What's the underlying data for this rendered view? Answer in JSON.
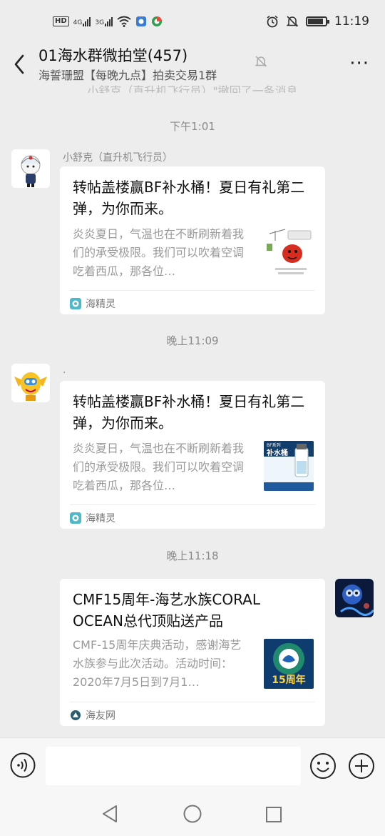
{
  "statusbar": {
    "hd": "HD",
    "net1": "4G",
    "net2": "3G",
    "time": "11:19"
  },
  "header": {
    "title": "01海水群微拍堂(457)",
    "subtitle": "海誓珊盟【每晚九点】拍卖交易1群",
    "more": "···"
  },
  "recall_notice": "小舒克（直升机飞行员）\"撤回了一条消息",
  "messages": [
    {
      "time": "下午1:01",
      "sender": "小舒克（直升机飞行员）",
      "title": "转帖盖楼赢BF补水桶！夏日有礼第二弹，为你而来。",
      "desc": "炎炎夏日，气温也在不断刷新着我们的承受极限。我们可以吹着空调吃着西瓜，那各位…",
      "source": "海精灵",
      "thumb_icon": "summer-aircon-thumbnail"
    },
    {
      "time": "晚上11:09",
      "sender": ".",
      "title": "转帖盖楼赢BF补水桶！夏日有礼第二弹，为你而来。",
      "desc": "炎炎夏日，气温也在不断刷新着我们的承受极限。我们可以吹着空调吃着西瓜，那各位…",
      "source": "海精灵",
      "thumb_label_small": "BF系列",
      "thumb_label": "补水桶"
    },
    {
      "time": "晚上11:18",
      "title": "CMF15周年-海艺水族CORAL OCEAN总代顶贴送产品",
      "desc": "CMF-15周年庆典活动，感谢海艺水族参与此次活动。活动时间：2020年7月5日到7月1…",
      "source": "海友网",
      "thumb_label": "15周年"
    }
  ],
  "colors": {
    "background": "#ededed",
    "card": "#ffffff",
    "source_icon": "#4fb8c9"
  }
}
